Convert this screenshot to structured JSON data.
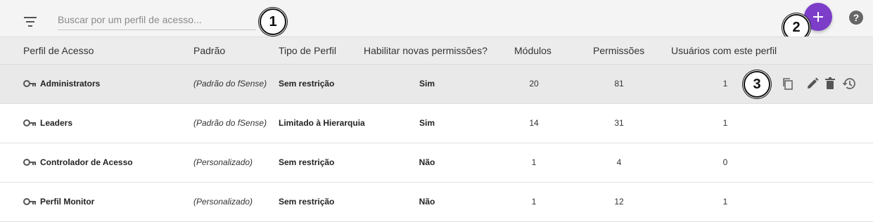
{
  "toolbar": {
    "filter_icon": "filter-list-icon",
    "search_placeholder": "Buscar por um perfil de acesso...",
    "search_value": "",
    "add_icon": "plus-icon",
    "help_icon": "help-circle-icon",
    "accent_color": "#7c3ec8"
  },
  "callouts": [
    "1",
    "2",
    "3"
  ],
  "table": {
    "headers": [
      "Perfil de Acesso",
      "Padrão",
      "Tipo de Perfil",
      "Habilitar novas permissões?",
      "Módulos",
      "Permissões",
      "Usuários com este perfil"
    ],
    "rows": [
      {
        "name": "Administrators",
        "padrao": "(Padrão do fSense)",
        "tipo": "Sem restrição",
        "habilitar": "Sim",
        "modulos": "20",
        "permissoes": "81",
        "usuarios": "1",
        "selected": true
      },
      {
        "name": "Leaders",
        "padrao": "(Padrão do fSense)",
        "tipo": "Limitado à Hierarquia",
        "habilitar": "Sim",
        "modulos": "14",
        "permissoes": "31",
        "usuarios": "1",
        "selected": false
      },
      {
        "name": "Controlador de Acesso",
        "padrao": "(Personalizado)",
        "tipo": "Sem restrição",
        "habilitar": "Não",
        "modulos": "1",
        "permissoes": "4",
        "usuarios": "0",
        "selected": false
      },
      {
        "name": "Perfil Monitor",
        "padrao": "(Personalizado)",
        "tipo": "Sem restrição",
        "habilitar": "Não",
        "modulos": "1",
        "permissoes": "12",
        "usuarios": "1",
        "selected": false
      }
    ],
    "row_icon": "key-icon",
    "row_actions": [
      "copy-icon",
      "edit-pencil-icon",
      "delete-trash-icon",
      "history-icon"
    ]
  }
}
